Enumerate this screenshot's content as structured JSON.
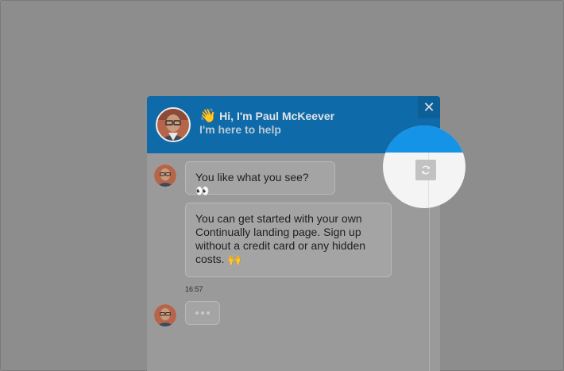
{
  "header": {
    "wave_emoji": "👋",
    "greeting": "Hi, I'm Paul McKeever",
    "subtitle": "I'm here to help",
    "close_label": "✕"
  },
  "messages": [
    {
      "text": "You like what you see? 👀"
    },
    {
      "text": "You can get started with your own Continually landing page. Sign up without a credit card or any hidden costs. 🙌"
    }
  ],
  "timestamp": "16:57",
  "icons": {
    "close": "close-icon",
    "refresh": "refresh-icon",
    "typing": "typing-dots-icon"
  },
  "colors": {
    "header_bg": "#0e6aa8",
    "spotlight_accent": "#1593e6",
    "overlay": "#8d8d8d"
  }
}
